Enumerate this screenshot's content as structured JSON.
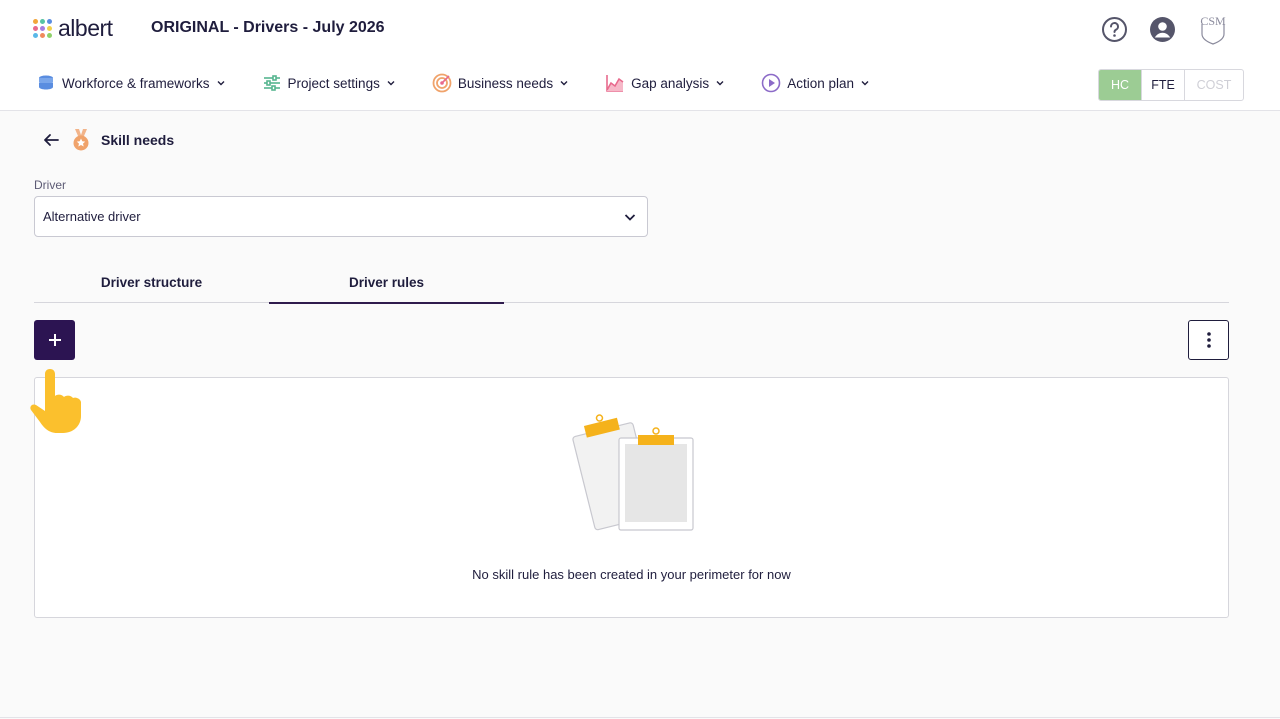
{
  "brand": {
    "logo_text": "albert"
  },
  "header": {
    "title": "ORIGINAL - Drivers - July 2026",
    "help_icon": "help-circle-icon",
    "account_icon": "user-account-icon",
    "org_logo": "CSM"
  },
  "nav": {
    "items": [
      {
        "label": "Workforce & frameworks",
        "icon": "database-icon"
      },
      {
        "label": "Project settings",
        "icon": "sliders-icon"
      },
      {
        "label": "Business needs",
        "icon": "target-icon"
      },
      {
        "label": "Gap analysis",
        "icon": "chart-line-icon"
      },
      {
        "label": "Action plan",
        "icon": "play-circle-icon"
      }
    ]
  },
  "unit_toggle": {
    "hc": "HC",
    "fte": "FTE",
    "cost": "COST",
    "selected": "HC"
  },
  "breadcrumb": {
    "title": "Skill needs"
  },
  "driver_field": {
    "label": "Driver",
    "value": "Alternative driver"
  },
  "tabs": [
    {
      "label": "Driver structure",
      "active": false
    },
    {
      "label": "Driver rules",
      "active": true
    }
  ],
  "empty_state": {
    "message": "No skill rule has been created in your perimeter for now"
  },
  "colors": {
    "primary": "#2c1452",
    "hc_active": "#9ccc94",
    "accent_orange": "#f5a623"
  }
}
